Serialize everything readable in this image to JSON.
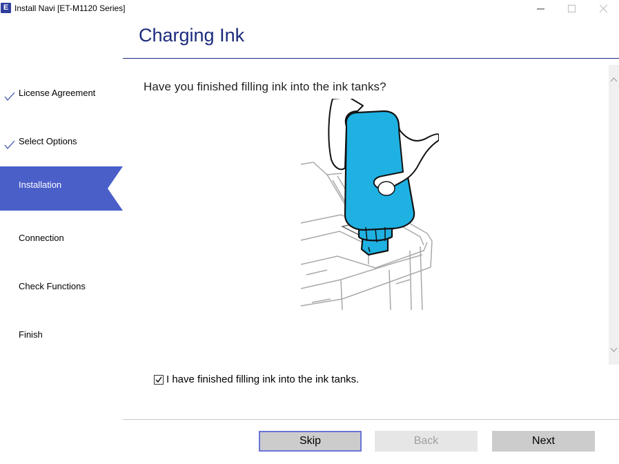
{
  "window": {
    "app_icon_letter": "E",
    "title": "Install Navi [ET-M1120 Series]",
    "controls": {
      "minimize": "minimize-icon",
      "maximize": "maximize-icon",
      "close": "close-icon"
    }
  },
  "header": {
    "title": "Charging Ink"
  },
  "sidebar": {
    "steps": [
      {
        "label": "License Agreement",
        "status": "completed"
      },
      {
        "label": "Select Options",
        "status": "completed"
      },
      {
        "label": "Installation",
        "status": "current"
      },
      {
        "label": "Connection",
        "status": "pending"
      },
      {
        "label": "Check Functions",
        "status": "pending"
      },
      {
        "label": "Finish",
        "status": "pending"
      }
    ]
  },
  "main": {
    "question": "Have you finished filling ink into the ink tanks?",
    "illustration": "ink-bottle-filling-tank",
    "ink_color": "#1fb1e2",
    "confirm_checkbox": {
      "label": "I have finished filling ink into the ink tanks.",
      "checked": true
    }
  },
  "buttons": {
    "skip": "Skip",
    "back": "Back",
    "next": "Next",
    "back_enabled": false
  },
  "colors": {
    "accent": "#4b5fc9",
    "title": "#1b2a7c"
  }
}
